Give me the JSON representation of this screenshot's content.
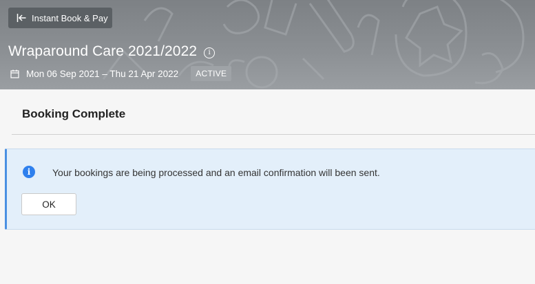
{
  "header": {
    "back_button_label": "Instant Book & Pay",
    "back_icon": "arrow-left-to-bar-icon",
    "title": "Wraparound Care 2021/2022",
    "title_info_icon": "info-circle-icon",
    "date_icon": "calendar-icon",
    "date_range": "Mon 06 Sep 2021 – Thu 21 Apr 2022",
    "status": "ACTIVE"
  },
  "section": {
    "title": "Booking Complete"
  },
  "alert": {
    "icon": "info-filled-icon",
    "message": "Your bookings are being processed and an email confirmation will been sent.",
    "ok_label": "OK",
    "accent_color": "#4a90e2"
  }
}
